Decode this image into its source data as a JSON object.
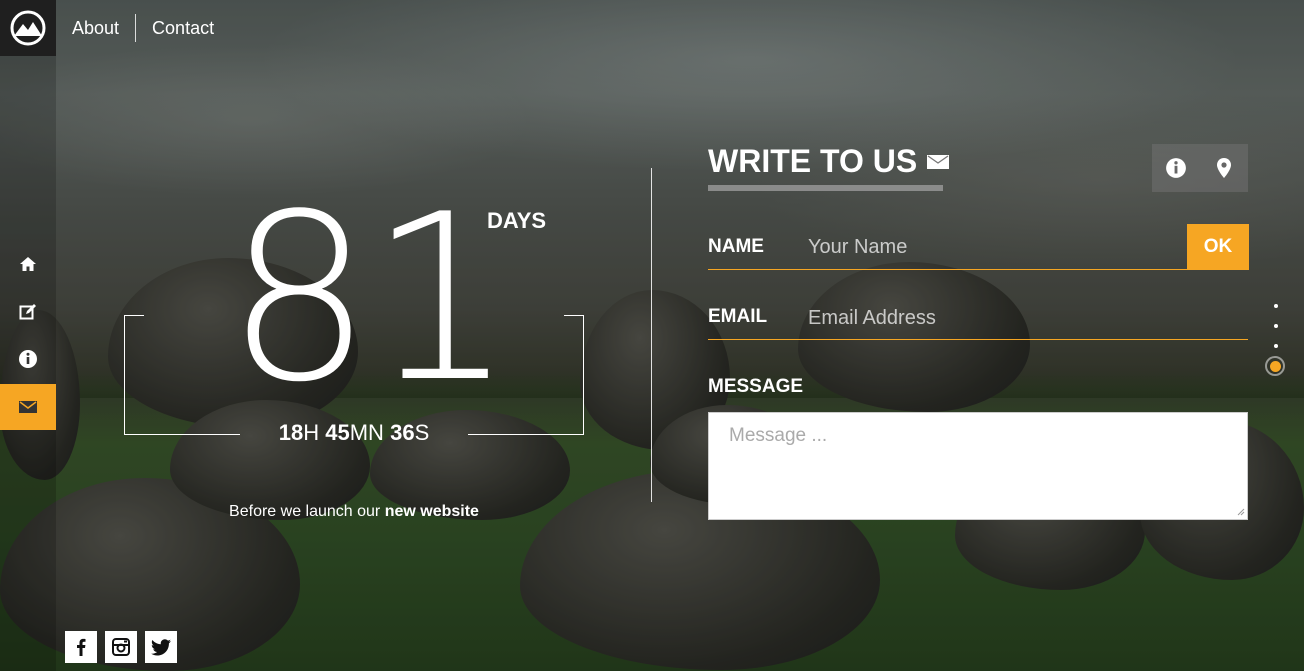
{
  "nav": {
    "about": "About",
    "contact": "Contact"
  },
  "sidebar": {
    "items": [
      {
        "icon": "home-icon"
      },
      {
        "icon": "edit-icon"
      },
      {
        "icon": "info-icon"
      },
      {
        "icon": "mail-icon",
        "active": true
      }
    ]
  },
  "countdown": {
    "days": "81",
    "days_label": "DAYS",
    "hours": "18",
    "hours_unit": "H",
    "minutes": "45",
    "minutes_unit": "MN",
    "seconds": "36",
    "seconds_unit": "S",
    "tagline_prefix": "Before we launch our ",
    "tagline_bold": "new website"
  },
  "form": {
    "title": "WRITE TO US",
    "name_label": "NAME",
    "name_placeholder": "Your Name",
    "email_label": "EMAIL",
    "email_placeholder": "Email Address",
    "message_label": "MESSAGE",
    "message_placeholder": "Message ...",
    "submit_label": "OK"
  },
  "colors": {
    "accent": "#f6a623"
  }
}
